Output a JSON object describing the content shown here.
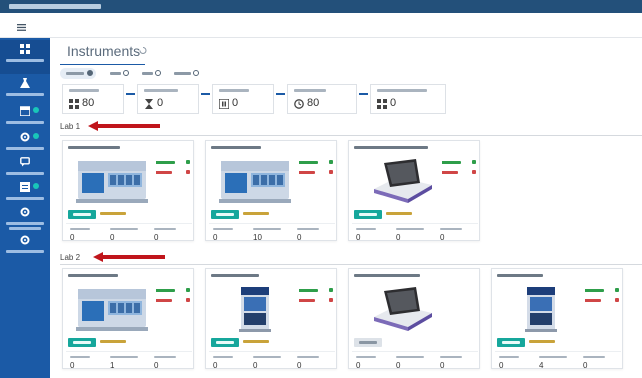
{
  "page": {
    "title": "Instruments"
  },
  "kpis": [
    {
      "value": "80",
      "icon": "grid-icon"
    },
    {
      "value": "0",
      "icon": "hourglass-icon"
    },
    {
      "value": "0",
      "icon": "pause-icon"
    },
    {
      "value": "80",
      "icon": "clock-icon"
    },
    {
      "value": "0",
      "icon": "grid-icon"
    }
  ],
  "labs": [
    {
      "label": "Lab 1",
      "cards": [
        {
          "image": "instrument-analyzer-image",
          "footer_values": [
            "0",
            "0",
            "0"
          ]
        },
        {
          "image": "instrument-analyzer-image",
          "footer_values": [
            "0",
            "10",
            "0"
          ]
        },
        {
          "image": "tablet-reader-image",
          "footer_values": [
            "0",
            "0",
            "0"
          ]
        }
      ]
    },
    {
      "label": "Lab 2",
      "cards": [
        {
          "image": "instrument-analyzer-image",
          "footer_values": [
            "0",
            "1",
            "0"
          ]
        },
        {
          "image": "tower-analyzer-image",
          "footer_values": [
            "0",
            "0",
            "0"
          ]
        },
        {
          "image": "tablet-reader-image",
          "footer_values": [
            "0",
            "0",
            "0"
          ]
        },
        {
          "image": "tower-analyzer-image",
          "footer_values": [
            "0",
            "4",
            "0"
          ]
        }
      ]
    }
  ],
  "colors": {
    "sidebar": "#1b5aa6",
    "titlebar": "#23507a",
    "accent_teal": "#16a79c",
    "status_green": "#2e9e4a",
    "status_red": "#d04646",
    "arrow_red": "#c0151b"
  }
}
